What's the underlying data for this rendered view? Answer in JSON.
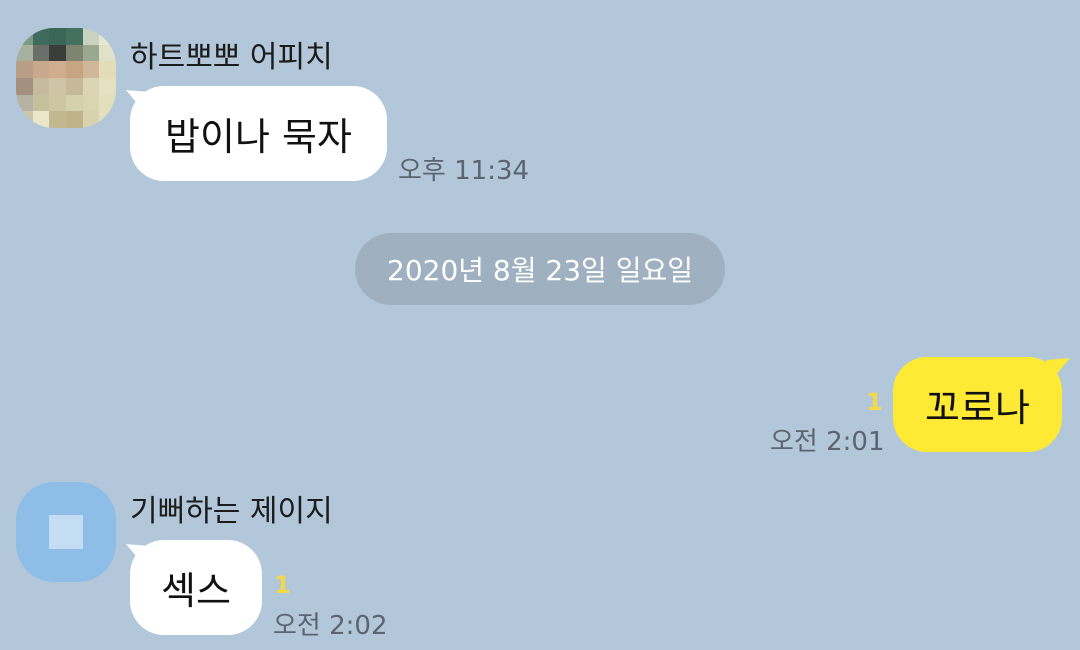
{
  "messages": [
    {
      "sender": "하트뽀뽀 어피치",
      "text": "밥이나 묵자",
      "time": "오후 11:34"
    },
    {
      "date_divider": "2020년 8월 23일 일요일"
    },
    {
      "text": "꼬로나",
      "unread": "1",
      "time": "오전 2:01"
    },
    {
      "sender": "기뻐하는 제이지",
      "text": "섹스",
      "unread": "1",
      "time": "오전 2:02"
    }
  ],
  "colors": {
    "background": "#b2c7da",
    "incoming_bubble": "#ffffff",
    "outgoing_bubble": "#fee934",
    "unread_count": "#f3d94a",
    "date_pill": "#9fb0c1"
  },
  "icons": {
    "avatar_1": "pixelated-profile-photo",
    "avatar_2": "default-profile-icon"
  }
}
